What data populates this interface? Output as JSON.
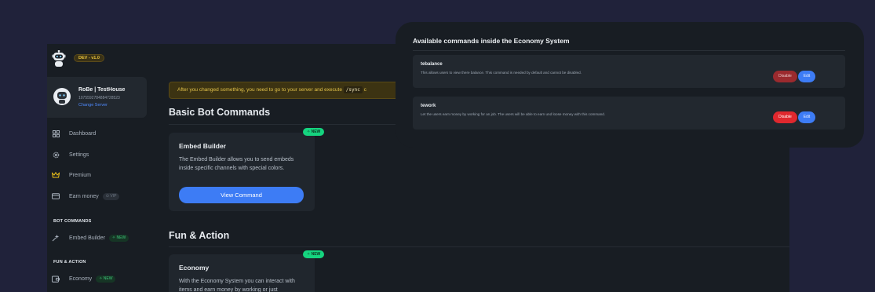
{
  "sidebar": {
    "version_badge": "DEV - v1.0",
    "server": {
      "name": "RoBe | TestHouse",
      "id": "1075592784884728523",
      "change_label": "Change Server"
    },
    "nav": [
      {
        "label": "Dashboard",
        "icon": "dashboard-icon"
      },
      {
        "label": "Settings",
        "icon": "gear-icon"
      },
      {
        "label": "Premium",
        "icon": "crown-icon"
      },
      {
        "label": "Earn money",
        "icon": "card-icon",
        "badge": "VIP"
      }
    ],
    "sections": [
      {
        "title": "BOT COMMANDS",
        "items": [
          {
            "label": "Embed Builder",
            "badge": "NEW",
            "icon": "embed-icon"
          }
        ]
      },
      {
        "title": "FUN & ACTION",
        "items": [
          {
            "label": "Economy",
            "badge": "NEW",
            "icon": "wallet-icon"
          }
        ]
      }
    ]
  },
  "main": {
    "notice": "After you changed something, you need to go to your server and execute",
    "notice_code": "/sync",
    "notice_tail": "c",
    "sections": [
      {
        "title": "Basic Bot Commands",
        "card": {
          "badge": "NEW",
          "title": "Embed Builder",
          "description": "The Embed Builder allows you to send embeds inside specific channels with special colors.",
          "button": "View Command"
        }
      },
      {
        "title": "Fun & Action",
        "card": {
          "badge": "NEW",
          "title": "Economy",
          "description": "With the Economy System you can interact with items and earn money by working or just"
        }
      }
    ]
  },
  "overlay": {
    "title": "Available commands inside the Economy System",
    "commands": [
      {
        "name": "tebalance",
        "description": "This allows users to view there balance. This command is needed by default and cannot be disabled.",
        "disable_label": "Disable",
        "edit_label": "Edit",
        "disable_color": "#9b2a2e"
      },
      {
        "name": "tework",
        "description": "Let the users earn money by working for an job. The users will be able to earn und loose money with this command.",
        "disable_label": "Disable",
        "edit_label": "Edit",
        "disable_color": "#e0282e"
      }
    ]
  },
  "colors": {
    "background": "#20223a",
    "panel": "#181d23",
    "accent": "#3d7cf5",
    "new_badge": "#15d47f",
    "warning": "#e2c24a"
  }
}
